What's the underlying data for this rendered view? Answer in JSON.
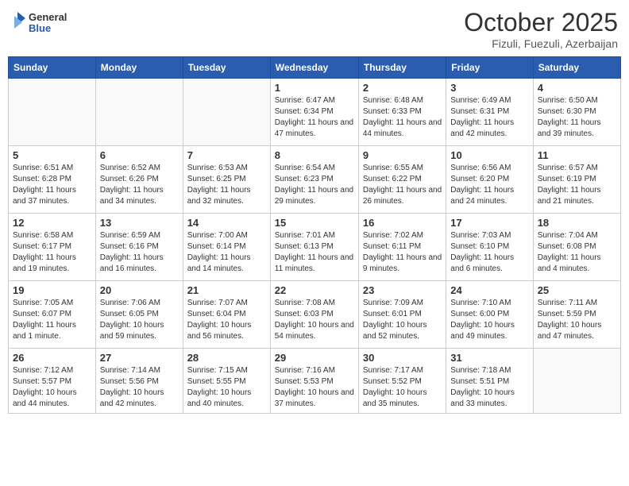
{
  "header": {
    "logo_line1": "General",
    "logo_line2": "Blue",
    "month": "October 2025",
    "location": "Fizuli, Fuezuli, Azerbaijan"
  },
  "weekdays": [
    "Sunday",
    "Monday",
    "Tuesday",
    "Wednesday",
    "Thursday",
    "Friday",
    "Saturday"
  ],
  "weeks": [
    [
      {
        "day": "",
        "text": ""
      },
      {
        "day": "",
        "text": ""
      },
      {
        "day": "",
        "text": ""
      },
      {
        "day": "1",
        "text": "Sunrise: 6:47 AM\nSunset: 6:34 PM\nDaylight: 11 hours and 47 minutes."
      },
      {
        "day": "2",
        "text": "Sunrise: 6:48 AM\nSunset: 6:33 PM\nDaylight: 11 hours and 44 minutes."
      },
      {
        "day": "3",
        "text": "Sunrise: 6:49 AM\nSunset: 6:31 PM\nDaylight: 11 hours and 42 minutes."
      },
      {
        "day": "4",
        "text": "Sunrise: 6:50 AM\nSunset: 6:30 PM\nDaylight: 11 hours and 39 minutes."
      }
    ],
    [
      {
        "day": "5",
        "text": "Sunrise: 6:51 AM\nSunset: 6:28 PM\nDaylight: 11 hours and 37 minutes."
      },
      {
        "day": "6",
        "text": "Sunrise: 6:52 AM\nSunset: 6:26 PM\nDaylight: 11 hours and 34 minutes."
      },
      {
        "day": "7",
        "text": "Sunrise: 6:53 AM\nSunset: 6:25 PM\nDaylight: 11 hours and 32 minutes."
      },
      {
        "day": "8",
        "text": "Sunrise: 6:54 AM\nSunset: 6:23 PM\nDaylight: 11 hours and 29 minutes."
      },
      {
        "day": "9",
        "text": "Sunrise: 6:55 AM\nSunset: 6:22 PM\nDaylight: 11 hours and 26 minutes."
      },
      {
        "day": "10",
        "text": "Sunrise: 6:56 AM\nSunset: 6:20 PM\nDaylight: 11 hours and 24 minutes."
      },
      {
        "day": "11",
        "text": "Sunrise: 6:57 AM\nSunset: 6:19 PM\nDaylight: 11 hours and 21 minutes."
      }
    ],
    [
      {
        "day": "12",
        "text": "Sunrise: 6:58 AM\nSunset: 6:17 PM\nDaylight: 11 hours and 19 minutes."
      },
      {
        "day": "13",
        "text": "Sunrise: 6:59 AM\nSunset: 6:16 PM\nDaylight: 11 hours and 16 minutes."
      },
      {
        "day": "14",
        "text": "Sunrise: 7:00 AM\nSunset: 6:14 PM\nDaylight: 11 hours and 14 minutes."
      },
      {
        "day": "15",
        "text": "Sunrise: 7:01 AM\nSunset: 6:13 PM\nDaylight: 11 hours and 11 minutes."
      },
      {
        "day": "16",
        "text": "Sunrise: 7:02 AM\nSunset: 6:11 PM\nDaylight: 11 hours and 9 minutes."
      },
      {
        "day": "17",
        "text": "Sunrise: 7:03 AM\nSunset: 6:10 PM\nDaylight: 11 hours and 6 minutes."
      },
      {
        "day": "18",
        "text": "Sunrise: 7:04 AM\nSunset: 6:08 PM\nDaylight: 11 hours and 4 minutes."
      }
    ],
    [
      {
        "day": "19",
        "text": "Sunrise: 7:05 AM\nSunset: 6:07 PM\nDaylight: 11 hours and 1 minute."
      },
      {
        "day": "20",
        "text": "Sunrise: 7:06 AM\nSunset: 6:05 PM\nDaylight: 10 hours and 59 minutes."
      },
      {
        "day": "21",
        "text": "Sunrise: 7:07 AM\nSunset: 6:04 PM\nDaylight: 10 hours and 56 minutes."
      },
      {
        "day": "22",
        "text": "Sunrise: 7:08 AM\nSunset: 6:03 PM\nDaylight: 10 hours and 54 minutes."
      },
      {
        "day": "23",
        "text": "Sunrise: 7:09 AM\nSunset: 6:01 PM\nDaylight: 10 hours and 52 minutes."
      },
      {
        "day": "24",
        "text": "Sunrise: 7:10 AM\nSunset: 6:00 PM\nDaylight: 10 hours and 49 minutes."
      },
      {
        "day": "25",
        "text": "Sunrise: 7:11 AM\nSunset: 5:59 PM\nDaylight: 10 hours and 47 minutes."
      }
    ],
    [
      {
        "day": "26",
        "text": "Sunrise: 7:12 AM\nSunset: 5:57 PM\nDaylight: 10 hours and 44 minutes."
      },
      {
        "day": "27",
        "text": "Sunrise: 7:14 AM\nSunset: 5:56 PM\nDaylight: 10 hours and 42 minutes."
      },
      {
        "day": "28",
        "text": "Sunrise: 7:15 AM\nSunset: 5:55 PM\nDaylight: 10 hours and 40 minutes."
      },
      {
        "day": "29",
        "text": "Sunrise: 7:16 AM\nSunset: 5:53 PM\nDaylight: 10 hours and 37 minutes."
      },
      {
        "day": "30",
        "text": "Sunrise: 7:17 AM\nSunset: 5:52 PM\nDaylight: 10 hours and 35 minutes."
      },
      {
        "day": "31",
        "text": "Sunrise: 7:18 AM\nSunset: 5:51 PM\nDaylight: 10 hours and 33 minutes."
      },
      {
        "day": "",
        "text": ""
      }
    ]
  ]
}
